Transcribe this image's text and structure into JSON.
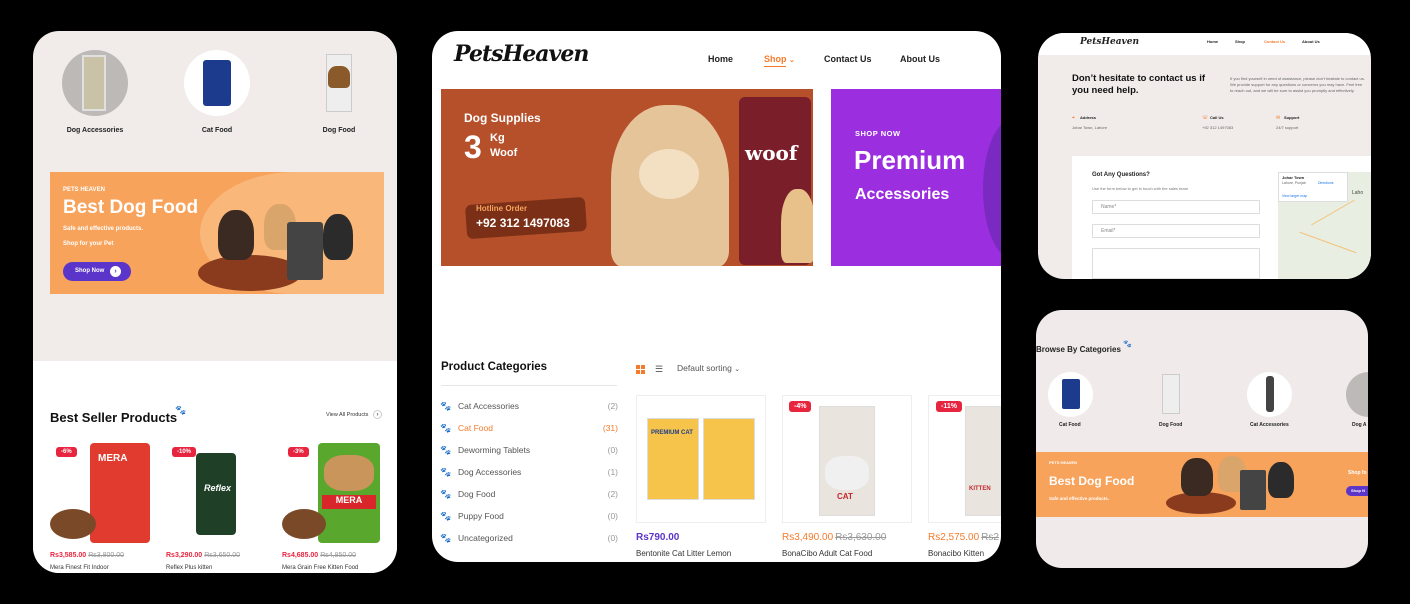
{
  "colors": {
    "orange": "#f7a35c",
    "purple": "#5b34c9",
    "red": "#e8253f",
    "brown": "#b5502a"
  },
  "panelA": {
    "categories": [
      {
        "label": "Dog Accessories"
      },
      {
        "label": "Cat Food"
      },
      {
        "label": "Dog Food"
      }
    ],
    "banner": {
      "brand": "PETS HEAVEN",
      "title": "Best Dog Food",
      "line1": "Safe and effective products.",
      "line2": "Shop for your Pet",
      "button": "Shop Now"
    },
    "best_seller_title": "Best Seller Products",
    "view_all": "View All Products",
    "products": [
      {
        "badge": "-6%",
        "price": "Rs3,585.00",
        "old": "Rs3,800.00",
        "name": "Mera Finest Fit Indoor",
        "brand": "MERA"
      },
      {
        "badge": "-10%",
        "price": "Rs3,290.00",
        "old": "Rs3,650.00",
        "name": "Reflex Plus kitten",
        "brand": "Reflex"
      },
      {
        "badge": "-3%",
        "price": "Rs4,685.00",
        "old": "Rs4,850.00",
        "name": "Mera Grain Free Kitten Food",
        "brand": "MERA"
      }
    ]
  },
  "panelB": {
    "logo": "PetsHeaven",
    "nav": [
      "Home",
      "Shop",
      "Contact Us",
      "About Us"
    ],
    "hero1": {
      "title": "Dog Supplies",
      "number": "3",
      "unit": "Kg",
      "sub": "Woof",
      "hotline_label": "Hotline Order",
      "hotline": "+92 312 1497083",
      "bag_text": "woof"
    },
    "hero2": {
      "tag": "SHOP NOW",
      "title": "Premium",
      "sub": "Accessories"
    },
    "sidebar_title": "Product Categories",
    "categories": [
      {
        "name": "Cat Accessories",
        "count": "(2)"
      },
      {
        "name": "Cat Food",
        "count": "(31)"
      },
      {
        "name": "Deworming Tablets",
        "count": "(0)"
      },
      {
        "name": "Dog Accessories",
        "count": "(1)"
      },
      {
        "name": "Dog Food",
        "count": "(2)"
      },
      {
        "name": "Puppy Food",
        "count": "(0)"
      },
      {
        "name": "Uncategorized",
        "count": "(0)"
      }
    ],
    "sorting": "Default sorting",
    "products": [
      {
        "badge": "",
        "price": "Rs790.00",
        "old": "",
        "name": "Bentonite Cat Litter Lemon",
        "bag_text": "PREMIUM CAT"
      },
      {
        "badge": "-4%",
        "price": "Rs3,490.00",
        "old": "Rs3,630.00",
        "name": "BonaCibo Adult Cat Food",
        "bag_text": "CAT"
      },
      {
        "badge": "-11%",
        "price": "Rs2,575.00",
        "old": "Rs2",
        "name": "Bonacibo Kitten",
        "bag_text": "KITTEN"
      }
    ]
  },
  "panelC": {
    "nav": [
      "Home",
      "Shop",
      "Contact Us",
      "About Us"
    ],
    "heading": "Don’t hesitate to contact us if you need help.",
    "paragraph": "If you find yourself in need of assistance, please don't hesitate to contact us. We provide support for any questions or concerns you may have. Feel free to reach out, and we will be sure to assist you promptly and effectively.",
    "info": [
      {
        "title": "Address",
        "value": "Johar Town, Lahore"
      },
      {
        "title": "Call Us",
        "value": "+92 312 1497083"
      },
      {
        "title": "Support",
        "value": "24/7 support"
      }
    ],
    "form_title": "Got Any Questions?",
    "form_sub": "Use the form below to get in touch with the sales team",
    "name_ph": "Name*",
    "email_ph": "Email*",
    "map_place": "Johar Town",
    "map_city": "Lahore, Punjab",
    "map_directions": "Directions",
    "map_link": "View larger map",
    "map_city2": "Laho"
  },
  "panelD": {
    "title": "Browse By Categories",
    "categories": [
      "Cat Food",
      "Dog Food",
      "Cat Accessories",
      "Dog A"
    ],
    "banner": {
      "brand": "PETS HEAVEN",
      "title": "Best Dog Food",
      "line1": "Safe and effective products.",
      "shop_for": "Shop fo",
      "button": "Shop N"
    }
  }
}
